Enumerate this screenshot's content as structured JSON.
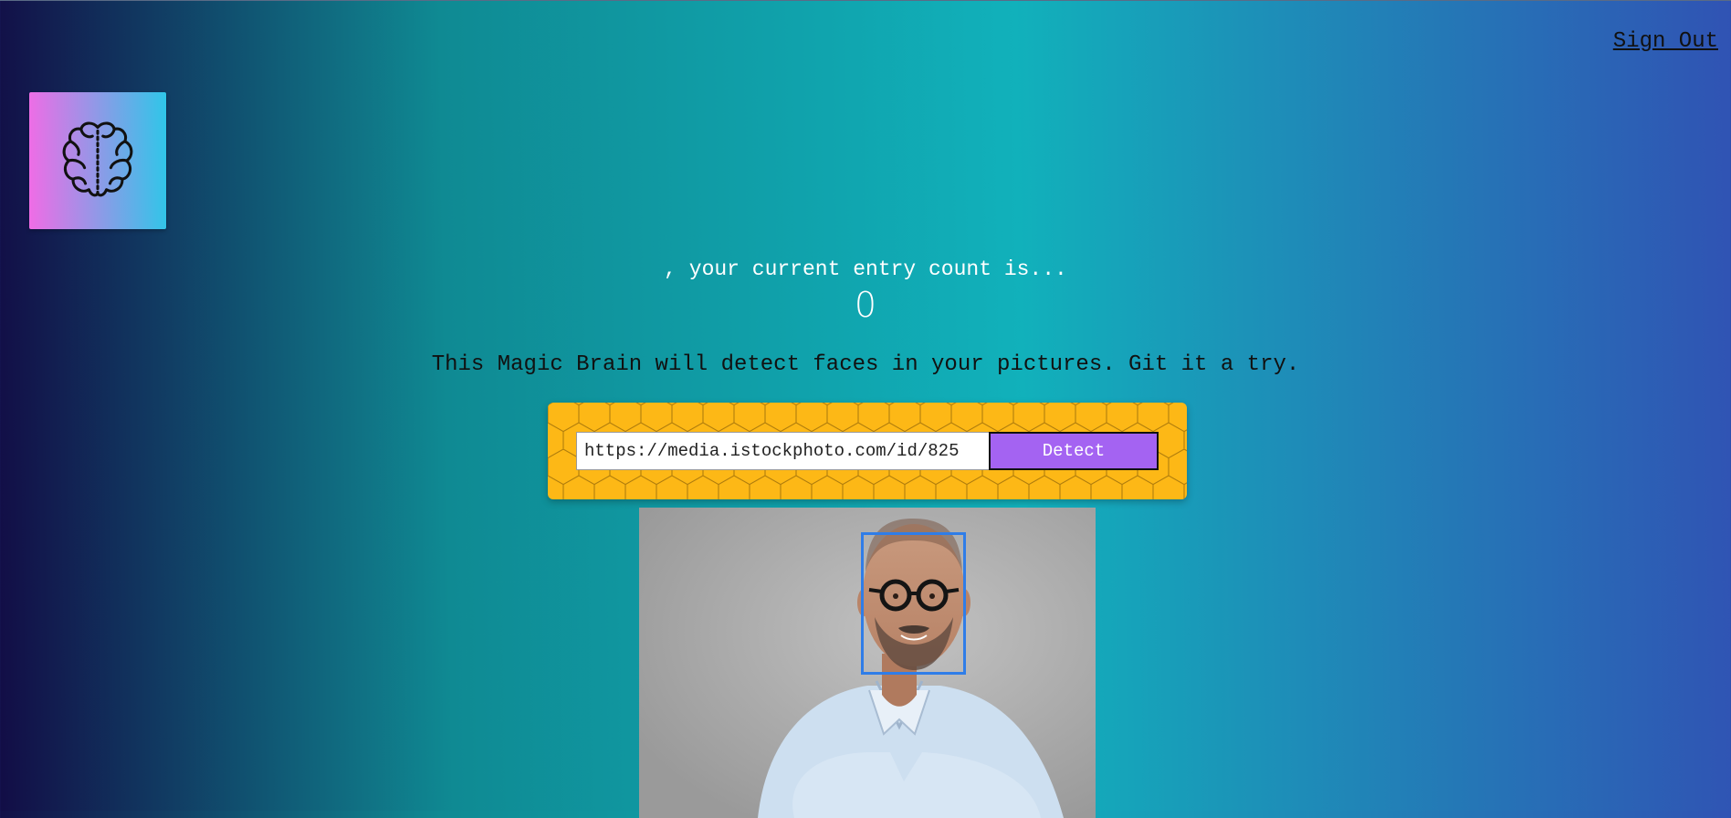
{
  "header": {
    "sign_out_label": "Sign Out"
  },
  "logo": {
    "icon": "brain-icon"
  },
  "rank": {
    "greeting": ", your current entry count is...",
    "count": "0"
  },
  "description": "This Magic Brain will detect faces in your pictures. Git it a try.",
  "form": {
    "url_value": "https://media.istockphoto.com/id/825",
    "detect_label": "Detect"
  },
  "colors": {
    "form_background": "#fdb816",
    "detect_button": "#a463f2",
    "bounding_box": "#2f7de8"
  },
  "image": {
    "subject": "smiling-man-portrait",
    "detected_faces": 1
  }
}
